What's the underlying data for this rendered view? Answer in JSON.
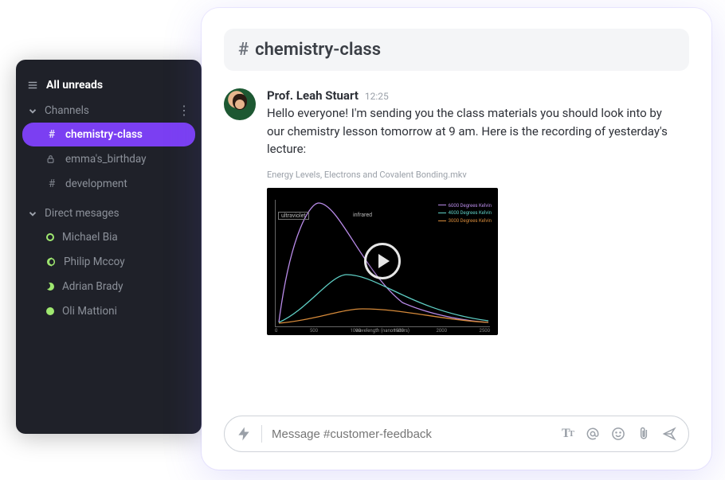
{
  "sidebar": {
    "header": "All unreads",
    "sections": [
      {
        "title": "Channels",
        "items": [
          {
            "icon": "hash",
            "label": "chemistry-class",
            "active": true
          },
          {
            "icon": "lock",
            "label": "emma's_birthday",
            "active": false
          },
          {
            "icon": "hash",
            "label": "development",
            "active": false
          }
        ]
      },
      {
        "title": "Direct mesages",
        "items": [
          {
            "presence": "ring",
            "label": "Michael Bia"
          },
          {
            "presence": "away",
            "label": "Philip Mccoy"
          },
          {
            "presence": "moon",
            "label": "Adrian Brady"
          },
          {
            "presence": "online",
            "label": "Oli Mattioni"
          }
        ]
      }
    ]
  },
  "channel": {
    "hash": "#",
    "name": "chemistry-class"
  },
  "message": {
    "author": "Prof. Leah Stuart",
    "time": "12:25",
    "body": "Hello everyone! I'm sending you the class materials you should look into by our chemistry lesson tomorrow at 9 am. Here is the recording of yesterday's lecture:",
    "attachment_name": "Energy Levels, Electrons and Covalent Bonding.mkv",
    "video": {
      "label_uv": "ultraviolet",
      "label_ir": "infrared",
      "legend": [
        "6000 Degrees Kelvin",
        "4000 Degrees Kelvin",
        "3000 Degrees Kelvin"
      ],
      "xlabel": "wavelength (nanometers)",
      "ticks": [
        "0",
        "500",
        "1000",
        "1500",
        "2000",
        "2500"
      ]
    }
  },
  "composer": {
    "placeholder": "Message #customer-feedback"
  }
}
